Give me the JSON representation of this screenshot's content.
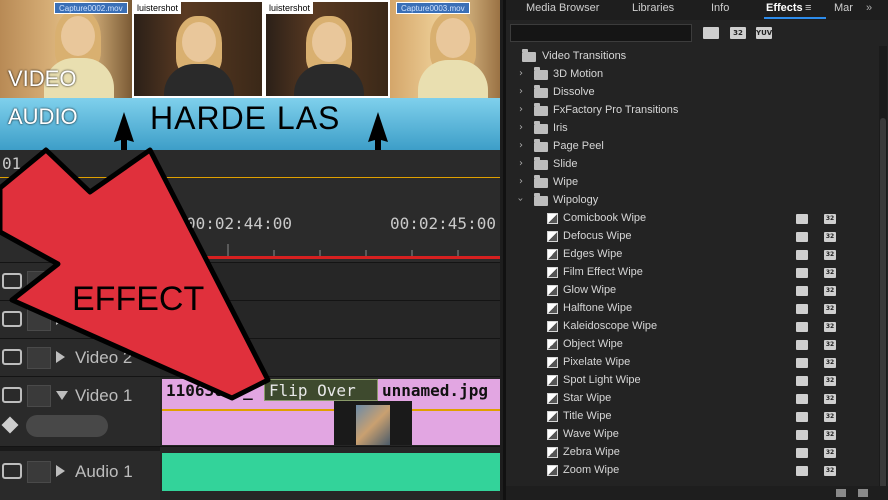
{
  "thumbnails": {
    "file_tag_1": "Capture0002.mov",
    "file_tag_2": "Capture0003.mov",
    "label_1": "luistershot",
    "label_2": "luistershot"
  },
  "overlay": {
    "video_label": "VIDEO",
    "audio_label": "AUDIO",
    "harde_las": "HARDE LAS",
    "effect_label": "EFFECT",
    "arrow_color": "#e0303c"
  },
  "timeline": {
    "frame_counter": "01",
    "playhead_timecode": "2:4",
    "ruler_ticks": [
      "00:02:44:00",
      "00:02:45:00"
    ],
    "tracks": [
      {
        "name": ""
      },
      {
        "name": ""
      },
      {
        "name": "Video 2"
      },
      {
        "name": "Video 1"
      },
      {
        "name": "Audio 1"
      }
    ],
    "clips": {
      "clip_a": "11063040_",
      "transition": "Flip Over",
      "clip_b": "unnamed.jpg"
    },
    "colors": {
      "video_clip": "#e2a6e2",
      "audio_clip": "#33d39a",
      "transition": "#3e4a2e"
    }
  },
  "effects_panel": {
    "tabs": [
      "Media Browser",
      "Libraries",
      "Info",
      "Effects",
      "Mar"
    ],
    "active_tab": "Effects",
    "search_value": "",
    "search_badges": [
      "",
      "32",
      "YUV"
    ],
    "root_folder": "Video Transitions",
    "folders": [
      "3D Motion",
      "Dissolve",
      "FxFactory Pro Transitions",
      "Iris",
      "Page Peel",
      "Slide",
      "Wipe",
      "Wipology"
    ],
    "wipology_items": [
      "Comicbook Wipe",
      "Defocus Wipe",
      "Edges Wipe",
      "Film Effect Wipe",
      "Glow Wipe",
      "Halftone Wipe",
      "Kaleidoscope Wipe",
      "Object Wipe",
      "Pixelate Wipe",
      "Spot Light Wipe",
      "Star Wipe",
      "Title Wipe",
      "Wave Wipe",
      "Zebra Wipe",
      "Zoom Wipe"
    ],
    "item_badges": [
      "",
      "32"
    ]
  }
}
